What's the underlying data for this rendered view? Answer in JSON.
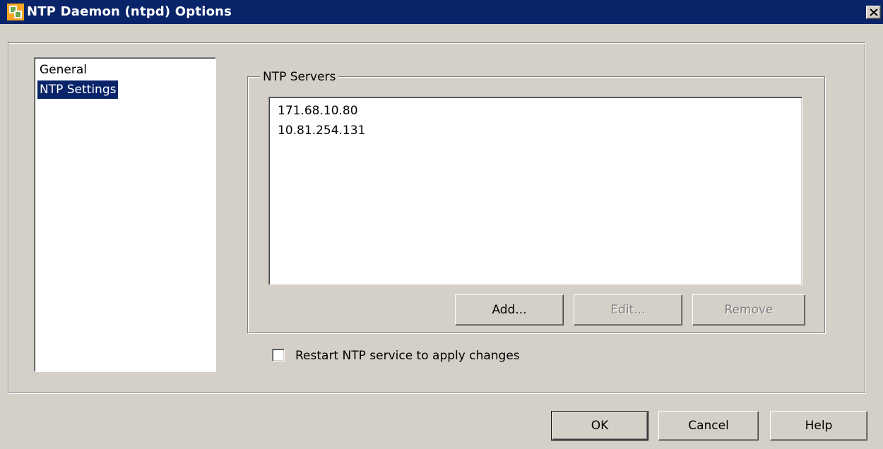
{
  "window": {
    "title": "NTP Daemon (ntpd) Options",
    "icon": "vsphere-app-icon",
    "close_icon": "close-icon"
  },
  "nav": {
    "items": [
      {
        "label": "General",
        "selected": false
      },
      {
        "label": "NTP Settings",
        "selected": true
      }
    ]
  },
  "ntp_servers": {
    "group_label": "NTP Servers",
    "servers": [
      "171.68.10.80",
      "10.81.254.131"
    ],
    "add_label": "Add...",
    "edit_label": "Edit...",
    "remove_label": "Remove",
    "edit_enabled": false,
    "remove_enabled": false
  },
  "restart": {
    "label": "Restart NTP service to apply changes",
    "checked": false
  },
  "footer": {
    "ok_label": "OK",
    "cancel_label": "Cancel",
    "help_label": "Help"
  },
  "colors": {
    "titlebar": "#0a246a",
    "selection": "#0a246a",
    "dialog_bg": "#d4d0c8"
  }
}
